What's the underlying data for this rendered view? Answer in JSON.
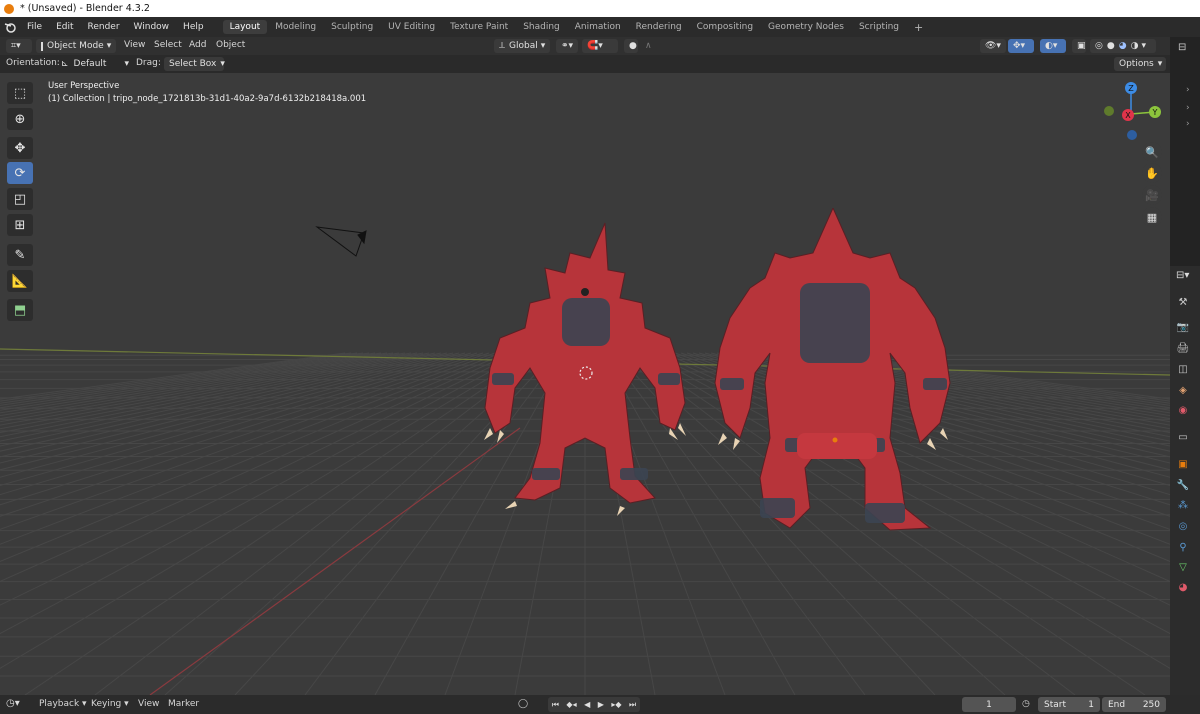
{
  "window": {
    "title": "* (Unsaved) - Blender 4.3.2"
  },
  "menu": [
    "File",
    "Edit",
    "Render",
    "Window",
    "Help"
  ],
  "workspaces": [
    {
      "label": "Layout",
      "active": true
    },
    {
      "label": "Modeling",
      "active": false
    },
    {
      "label": "Sculpting",
      "active": false
    },
    {
      "label": "UV Editing",
      "active": false
    },
    {
      "label": "Texture Paint",
      "active": false
    },
    {
      "label": "Shading",
      "active": false
    },
    {
      "label": "Animation",
      "active": false
    },
    {
      "label": "Rendering",
      "active": false
    },
    {
      "label": "Compositing",
      "active": false
    },
    {
      "label": "Geometry Nodes",
      "active": false
    },
    {
      "label": "Scripting",
      "active": false
    }
  ],
  "add_workspace": "+",
  "header": {
    "mode": "Object Mode",
    "menus": [
      "View",
      "Select",
      "Add",
      "Object"
    ],
    "transform_orientation": "Global"
  },
  "toolsettings": {
    "orientation_label": "Orientation:",
    "orientation_value": "Default",
    "drag_label": "Drag:",
    "drag_value": "Select Box",
    "options": "Options"
  },
  "viewport": {
    "perspective": "User Perspective",
    "collection": "(1) Collection | tripo_node_1721813b-31d1-40a2-9a7d-6132b218418a.001",
    "background_color": "#3b3b3b"
  },
  "gizmo": {
    "z": "Z",
    "y": "Y",
    "x": "X"
  },
  "timeline": {
    "menus": [
      "Playback",
      "Keying",
      "View",
      "Marker"
    ],
    "current_frame": "1",
    "start_label": "Start",
    "start_value": "1",
    "end_label": "End",
    "end_value": "250"
  },
  "colors": {
    "accent": "#4772b3",
    "x_axis": "#e0344a",
    "y_axis": "#8cc43c",
    "z_axis": "#3c8ce6",
    "creature_red": "#b7343a"
  }
}
